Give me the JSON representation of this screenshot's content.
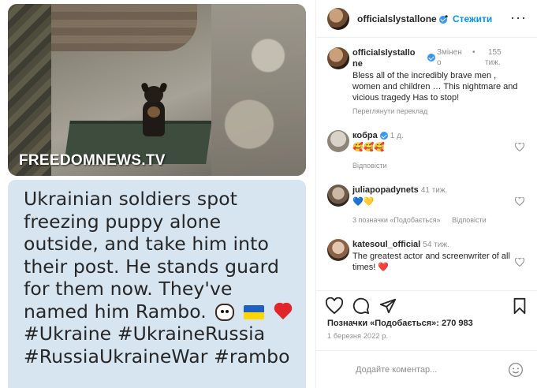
{
  "media": {
    "watermark": "FREEDOMNEWS.TV",
    "caption_lines": [
      "Ukrainian soldiers spot",
      "freezing puppy alone",
      "outside, and take him into",
      "their post. He stands guard",
      "for them now. They've",
      "named him Rambo.",
      "#Ukraine #UkraineRussia",
      "#RussiaUkraineWar #rambo"
    ],
    "caption_emojis": [
      "dog-face-emoji",
      "ukraine-flag-emoji",
      "red-heart-emoji"
    ]
  },
  "header": {
    "username": "officialslystallone",
    "dot": "•",
    "follow_label": "Стежити",
    "more_label": "···"
  },
  "caption_comment": {
    "username_line1": "officialslystallo",
    "username_line2": "ne",
    "edited": "Змінен",
    "edited2": "о",
    "age_dot": "•",
    "age": "155",
    "age2": "тиж.",
    "text": "Bless all of the incredibly brave men , women and children … This nightmare and vicious tragedy Has to stop!",
    "see_translation": "Переглянути переклад"
  },
  "comments": [
    {
      "username": "кобра",
      "verified": true,
      "age": "1 д.",
      "text": "🥰🥰🥰",
      "reply_label": "Відповісти",
      "likes": ""
    },
    {
      "username": "juliapopadynets",
      "verified": false,
      "age": "41 тиж.",
      "text": "💙💛",
      "likes": "3 позначки «Подобається»",
      "reply_label": "Відповісти"
    },
    {
      "username": "katesoul_official",
      "verified": false,
      "age": "54 тиж.",
      "text": "The greatest actor and screenwriter of all times! ❤️",
      "likes": "",
      "reply_label": ""
    }
  ],
  "post_footer": {
    "likes_text": "Позначки «Подобається»: 270 983",
    "date": "1 березня 2022 р.",
    "comment_placeholder": "Додайте коментар..."
  },
  "colors": {
    "accent": "#0095f6",
    "verified": "#3897f0",
    "caption_card_bg": "#d7e5f1",
    "text": "#262626",
    "muted": "#8e8e8e"
  },
  "icons": [
    "heart-icon",
    "comment-icon",
    "share-icon",
    "bookmark-icon",
    "smile-icon",
    "verified-icon",
    "more-icon"
  ]
}
